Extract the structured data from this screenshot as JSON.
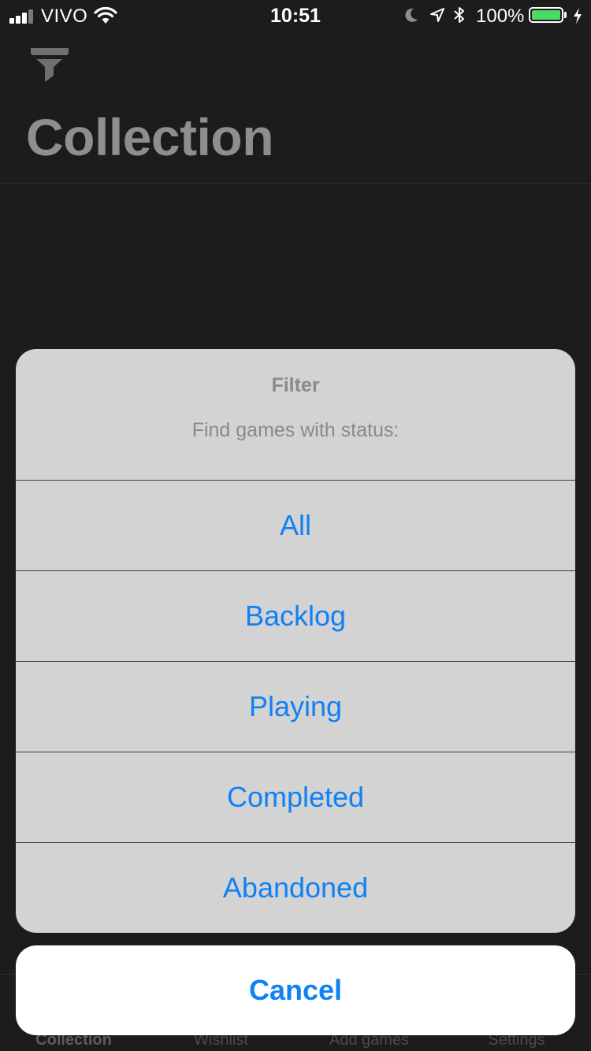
{
  "status_bar": {
    "carrier": "VIVO",
    "time": "10:51",
    "battery": "100%",
    "battery_level": 1.0,
    "battery_color": "#4cd964"
  },
  "header": {
    "filter_icon": "funnel-icon",
    "title": "Collection"
  },
  "action_sheet": {
    "title": "Filter",
    "message": "Find games with status:",
    "options": [
      "All",
      "Backlog",
      "Playing",
      "Completed",
      "Abandoned"
    ],
    "cancel_label": "Cancel",
    "accent_color": "#1081f5"
  },
  "tab_bar": {
    "items": [
      {
        "label": "Collection",
        "active": true
      },
      {
        "label": "Wishlist",
        "active": false
      },
      {
        "label": "Add games",
        "active": false
      },
      {
        "label": "Settings",
        "active": false
      }
    ]
  }
}
